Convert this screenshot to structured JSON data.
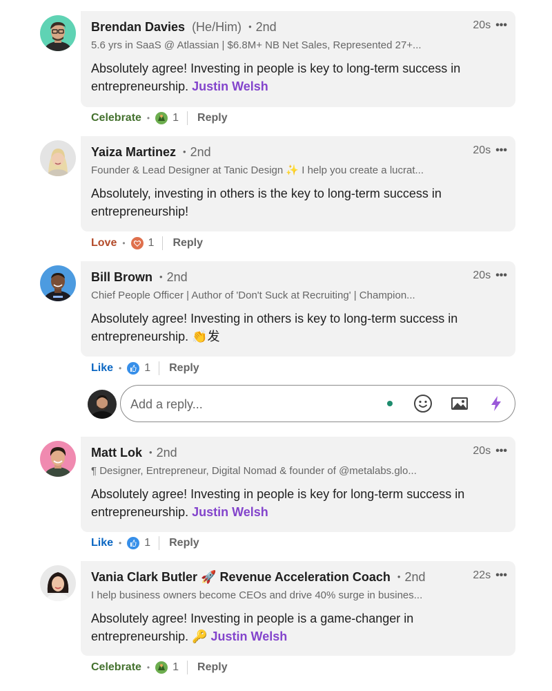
{
  "comments": [
    {
      "name": "Brendan Davies",
      "pronouns": "(He/Him)",
      "degree": "2nd",
      "time": "20s",
      "headline": "5.6 yrs in SaaS @ Atlassian | $6.8M+ NB Net Sales, Represented 27+...",
      "body": "Absolutely agree! Investing in people is key to long-term success in entrepreneurship.",
      "mention": "Justin Welsh",
      "reaction_label": "Celebrate",
      "reaction_icon": "celebrate-icon",
      "reaction_count": "1",
      "reply_label": "Reply"
    },
    {
      "name": "Yaiza Martinez",
      "degree": "2nd",
      "time": "20s",
      "headline": "Founder & Lead Designer at Tanic Design ✨ I help you create a lucrat...",
      "body": "Absolutely, investing in others is the key to long-term success in entrepreneurship!",
      "reaction_label": "Love",
      "reaction_icon": "love-icon",
      "reaction_count": "1",
      "reply_label": "Reply"
    },
    {
      "name": "Bill Brown",
      "degree": "2nd",
      "time": "20s",
      "headline": "Chief People Officer | Author of 'Don't Suck at Recruiting' | Champion...",
      "body": "Absolutely agree! Investing in others is key to long-term success in entrepreneurship. 👏发",
      "reaction_label": "Like",
      "reaction_icon": "like-icon",
      "reaction_count": "1",
      "reply_label": "Reply"
    },
    {
      "name": "Matt Lok",
      "degree": "2nd",
      "time": "20s",
      "headline": "¶ Designer, Entrepreneur, Digital Nomad & founder of @metalabs.glo...",
      "body": "Absolutely agree! Investing in people is key for long-term success in entrepreneurship.",
      "mention": "Justin Welsh",
      "reaction_label": "Like",
      "reaction_icon": "like-icon",
      "reaction_count": "1",
      "reply_label": "Reply"
    },
    {
      "name": "Vania Clark Butler 🚀 Revenue Acceleration Coach",
      "degree": "2nd",
      "time": "22s",
      "headline": "I help business owners become CEOs and drive 40% surge in busines...",
      "body": "Absolutely agree! Investing in people is a game-changer in entrepreneurship. 🔑",
      "mention": "Justin Welsh",
      "reaction_label": "Celebrate",
      "reaction_icon": "celebrate-icon",
      "reaction_count": "1",
      "reply_label": "Reply"
    }
  ],
  "reply_box": {
    "placeholder": "Add a reply...",
    "icons": [
      "emoji-icon",
      "image-icon",
      "lightning-icon"
    ]
  },
  "colors": {
    "celebrate": "#44712e",
    "love": "#b34b2a",
    "like": "#0a66c2",
    "mention": "#8344cc",
    "bubble": "#f2f2f2"
  }
}
